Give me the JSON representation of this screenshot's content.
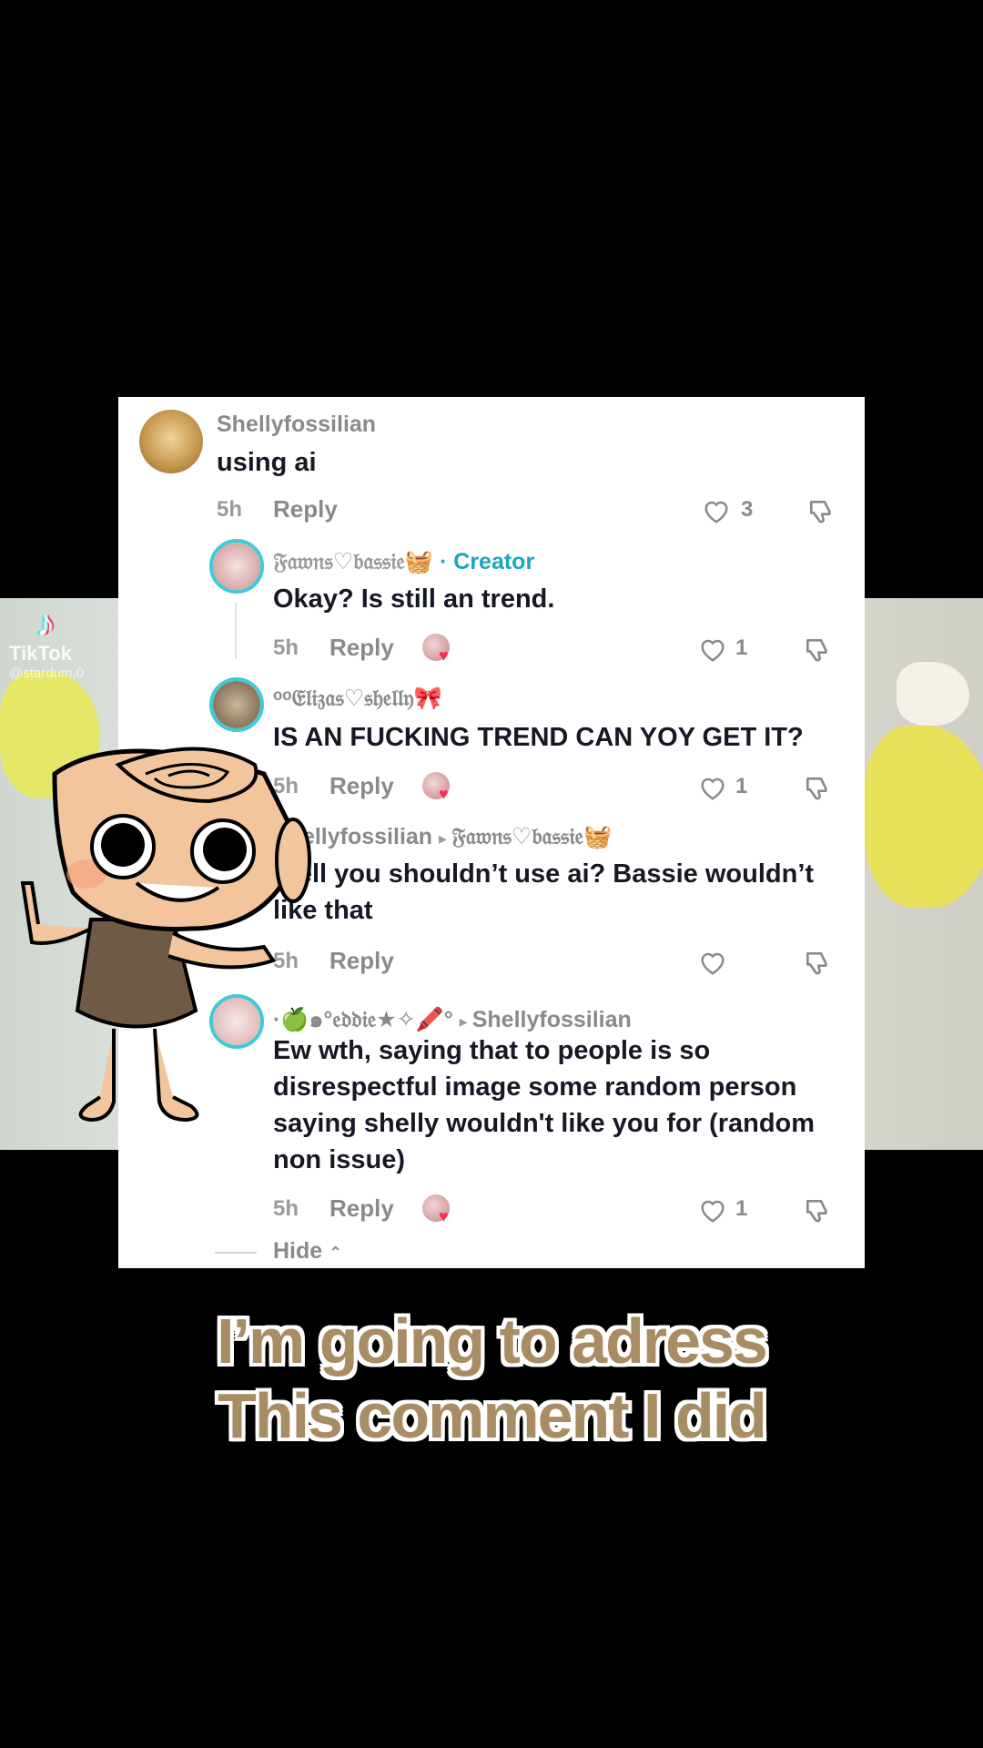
{
  "watermark": {
    "app": "TikTok",
    "user": "@stardum.0"
  },
  "comments": [
    {
      "username": "Shellyfossilian",
      "text": "using ai",
      "time": "5h",
      "reply_label": "Reply",
      "likes": "3"
    },
    {
      "username": "𝔉𝔞𝔴𝔫𝔰♡𝔟𝔞𝔰𝔰𝔦𝔢🧺",
      "creator_label": "· Creator",
      "text": "Okay? Is still an trend.",
      "time": "5h",
      "reply_label": "Reply",
      "likes": "1"
    },
    {
      "username": "ᵒᵒ𝔈𝔩𝔦𝔷𝔞𝔰♡𝔰𝔥𝔢𝔩𝔩𝔶🎀",
      "text": "IS AN FUCKING TREND CAN YOY GET IT?",
      "time": "5h",
      "reply_label": "Reply",
      "likes": "1"
    },
    {
      "username": "Shellyfossilian",
      "reply_to": "𝔉𝔞𝔴𝔫𝔰♡𝔟𝔞𝔰𝔰𝔦𝔢🧺",
      "text": "Well you shouldn’t use ai? Bassie wouldn’t like that",
      "time": "5h",
      "reply_label": "Reply",
      "likes": ""
    },
    {
      "username": "·🍏๑°𝔢𝔡𝔡𝔦𝔢★✧🖍️°",
      "reply_to": "Shellyfossilian",
      "text": "Ew wth, saying that to people is so disrespectful image some random person saying shelly wouldn't like you for (random non issue)",
      "time": "5h",
      "reply_label": "Reply",
      "likes": "1"
    }
  ],
  "hide_label": "Hide",
  "caption_lines": [
    "I’m going to adress",
    "This comment I did"
  ],
  "colors": {
    "creator": "#1ba5bd",
    "ring": "#41c9d8",
    "caption": "#a88c64"
  },
  "icons": [
    "heart-icon",
    "dislike-icon",
    "chevron-up-icon",
    "tiktok-logo-icon"
  ]
}
